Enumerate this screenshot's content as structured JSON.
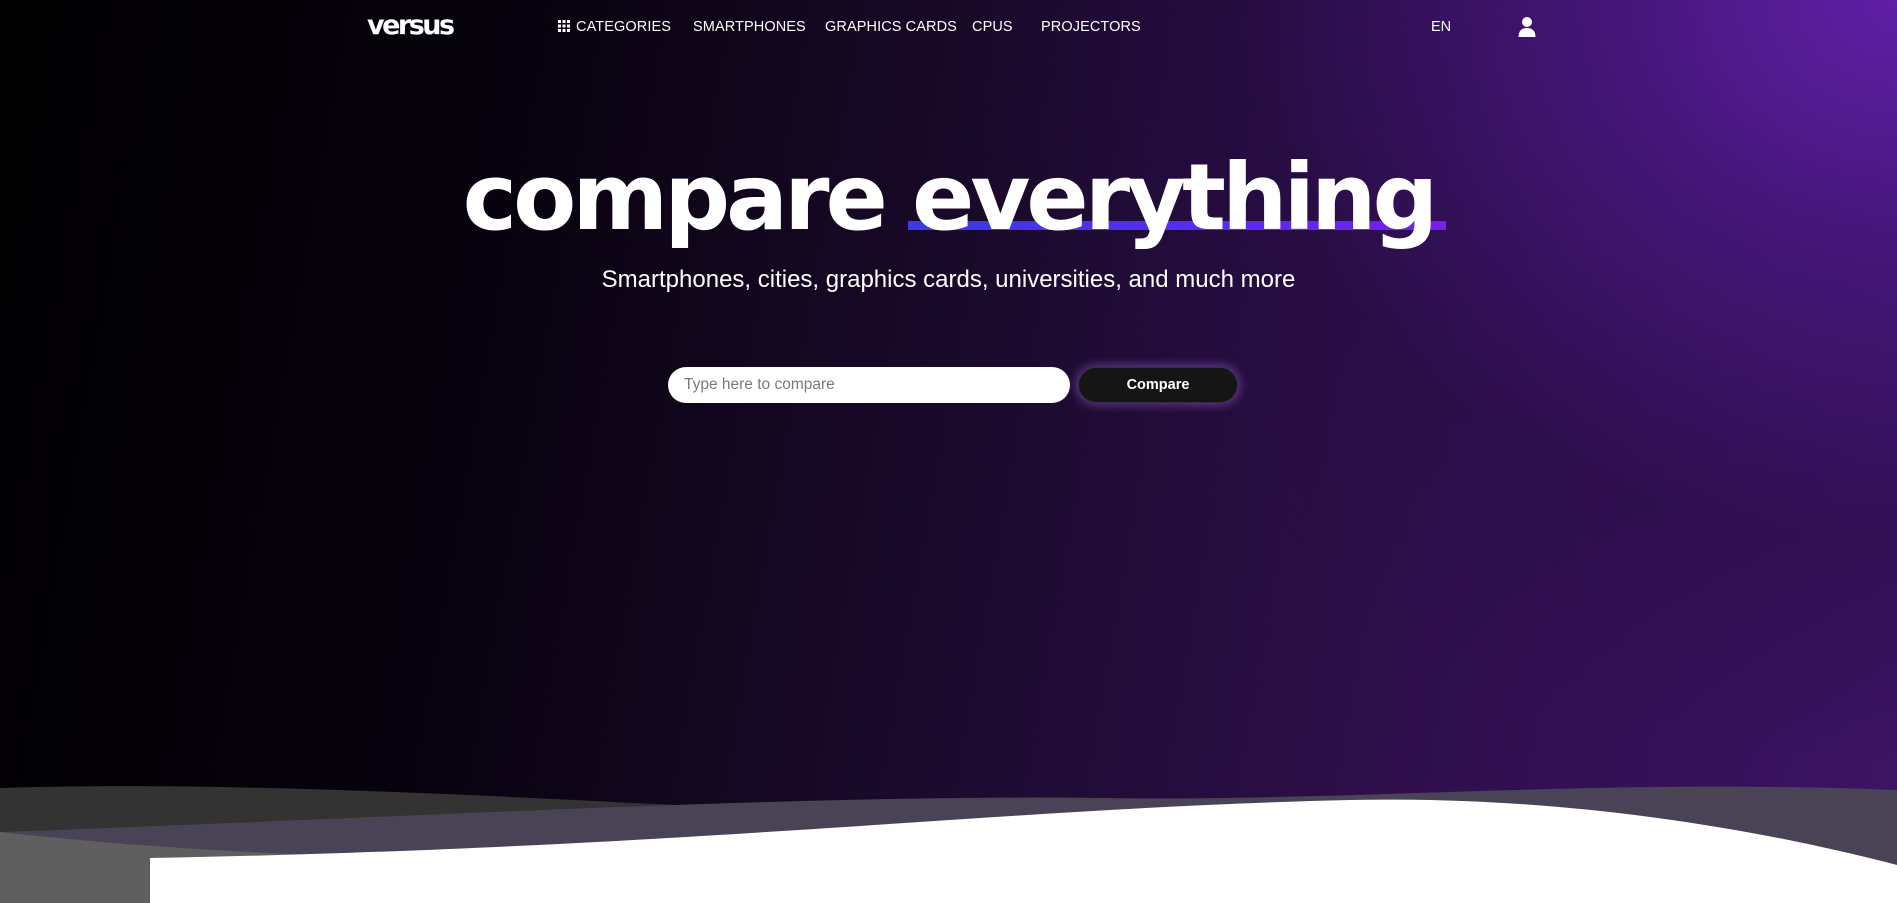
{
  "nav": {
    "logo": "versus",
    "items": [
      {
        "label": "CATEGORIES",
        "icon": "grid-icon"
      },
      {
        "label": "SMARTPHONES"
      },
      {
        "label": "GRAPHICS CARDS"
      },
      {
        "label": "CPUS"
      },
      {
        "label": "PROJECTORS"
      }
    ],
    "language": "EN",
    "account_icon": "user-icon"
  },
  "hero": {
    "headline_part1": "compare",
    "headline_part2": "everything",
    "subtitle": "Smartphones, cities, graphics cards, universities, and much more"
  },
  "search": {
    "placeholder": "Type here to compare",
    "value": "",
    "button_label": "Compare"
  },
  "colors": {
    "accent_underline": "#4b2ee8",
    "background_dark": "#000000",
    "background_purple": "#5a1f9a",
    "button_bg": "#151515"
  }
}
